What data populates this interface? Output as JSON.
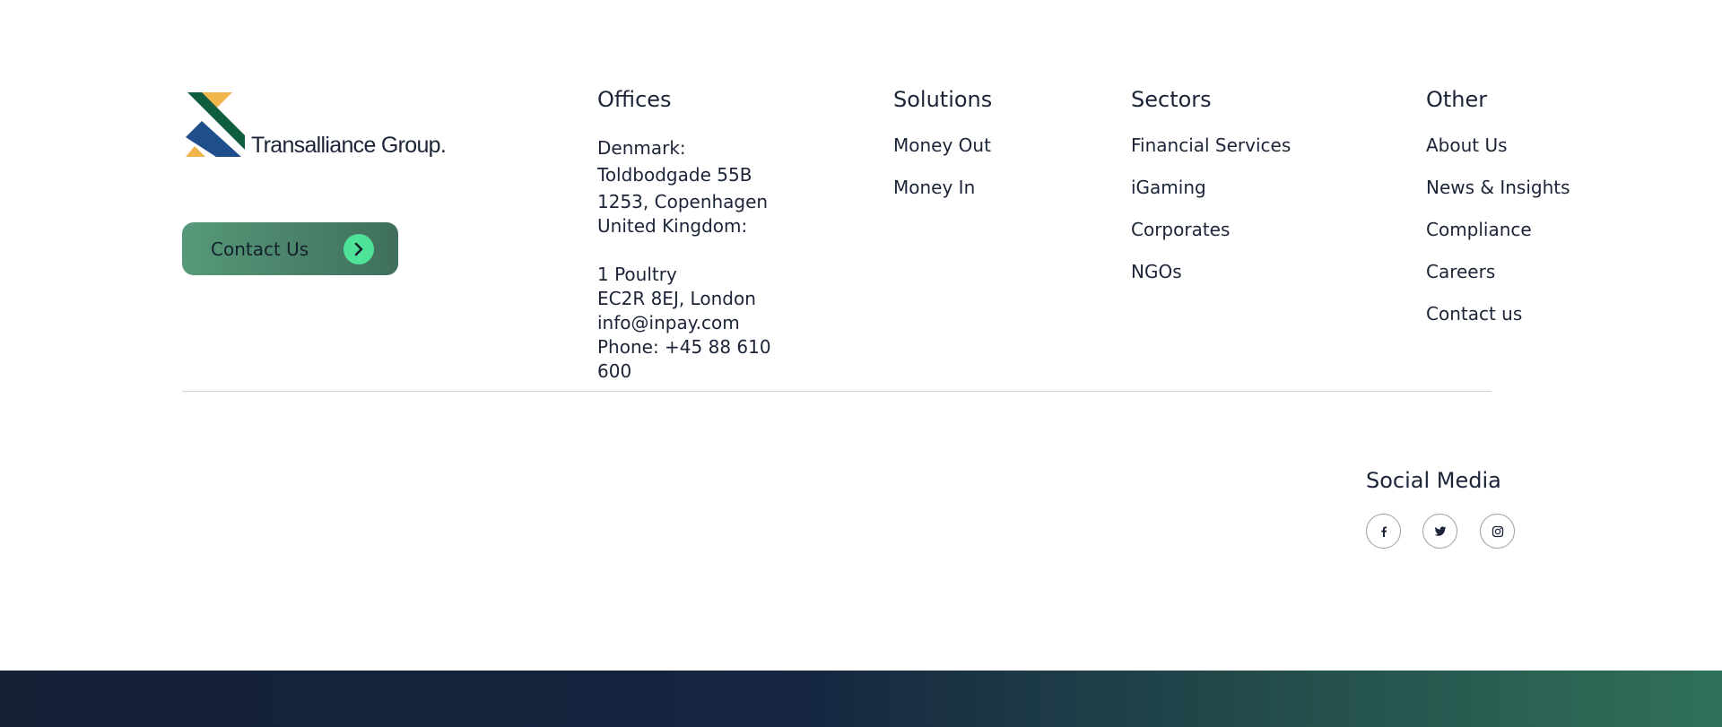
{
  "brand": {
    "name": "Transalliance Group."
  },
  "contact_button": {
    "label": "Contact Us"
  },
  "offices": {
    "heading": "Offices",
    "lines": [
      "Denmark:",
      "Toldbodgade 55B",
      "1253, Copenhagen",
      "United Kingdom:",
      "",
      "1 Poultry",
      "EC2R 8EJ, London",
      "info@inpay.com",
      "Phone: +45 88 610",
      "600"
    ]
  },
  "solutions": {
    "heading": "Solutions",
    "items": [
      "Money Out",
      "Money In"
    ]
  },
  "sectors": {
    "heading": "Sectors",
    "items": [
      "Financial Services",
      "iGaming",
      "Corporates",
      "NGOs"
    ]
  },
  "other": {
    "heading": "Other",
    "items": [
      "About Us",
      "News & Insights",
      "Compliance",
      "Careers",
      "Contact us"
    ]
  },
  "social": {
    "heading": "Social Media",
    "icons": [
      "facebook-icon",
      "twitter-icon",
      "instagram-icon"
    ]
  },
  "colors": {
    "text": "#1c2438",
    "logo_green": "#0f5c3e",
    "logo_blue": "#1e4e8c",
    "logo_yellow": "#f0b54b",
    "button_start": "#56997a",
    "button_end": "#3f6f5b",
    "arrow_circle": "#4fe39a",
    "band_start": "#142036",
    "band_end": "#2f7159"
  }
}
